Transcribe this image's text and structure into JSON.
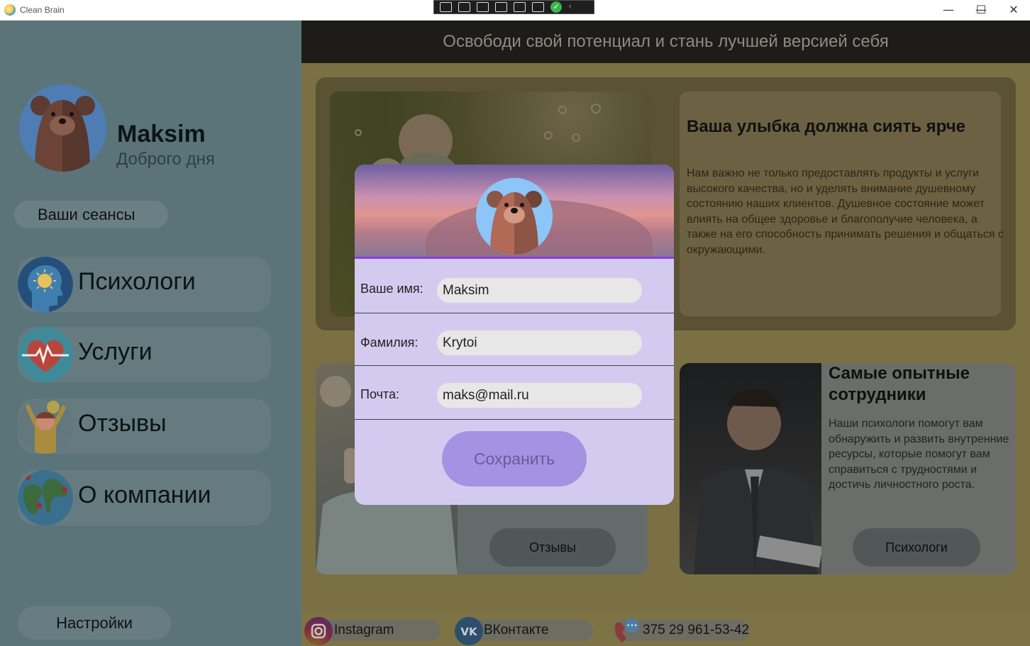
{
  "window": {
    "title": "Clean Brain",
    "minimize": "—",
    "maximize": "☐",
    "close": "✕"
  },
  "sidebar": {
    "user_name": "Maksim",
    "greeting": "Доброго дня",
    "sessions_label": "Ваши сеансы",
    "nav": [
      {
        "label": "Психологи",
        "icon": "brain-head-icon"
      },
      {
        "label": "Услуги",
        "icon": "heart-pulse-icon"
      },
      {
        "label": "Отзывы",
        "icon": "happy-person-icon"
      },
      {
        "label": "О компании",
        "icon": "globe-pins-icon"
      }
    ],
    "settings_label": "Настройки"
  },
  "main": {
    "header": "Освободи свой потенциал и стань лучшей версией себя",
    "card1": {
      "title": "Ваша улыбка должна сиять ярче",
      "body": "Нам важно не только предоставлять продукты и услуги высокого качества, но и уделять внимание душевному состоянию наших клиентов. Душевное состояние может влиять на общее здоровье и благополучие человека, а также на его способность принимать решения и общаться с окружающими."
    },
    "card2": {
      "button": "Отзывы"
    },
    "card3": {
      "title": "Самые опытные сотрудники",
      "body": "Наши психологи помогут вам обнаружить и развить внутренние ресурсы, которые помогут вам справиться с трудностями и достичь личностного роста.",
      "button": "Психологи"
    },
    "footer": {
      "instagram": "Instagram",
      "vk": "ВКонтакте",
      "phone": "375 29 961-53-42"
    }
  },
  "modal": {
    "name_label": "Ваше имя:",
    "name_value": "Maksim",
    "surname_label": "Фамилия:",
    "surname_value": "Krytoi",
    "email_label": "Почта:",
    "email_value": "maks@mail.ru",
    "save_label": "Сохранить"
  }
}
